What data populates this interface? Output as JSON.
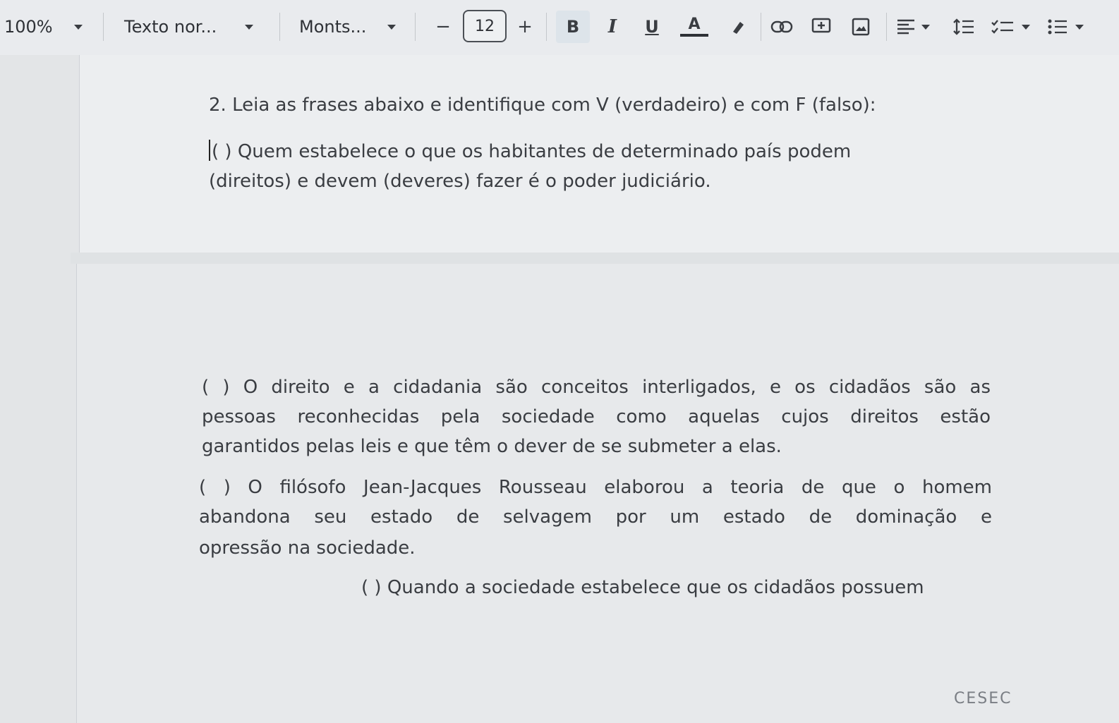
{
  "toolbar": {
    "zoom": "100%",
    "style": "Texto nor...",
    "font": "Monts...",
    "decrease": "−",
    "font_size": "12",
    "increase": "+",
    "bold": "B",
    "italic": "I",
    "underline": "U",
    "text_color": "A"
  },
  "doc": {
    "question": "2. Leia as frases abaixo e identifique com V (verdadeiro) e com F (falso):",
    "item1_line1": "( ) Quem estabelece o que os habitantes de determinado país podem",
    "item1_line2": "(direitos) e devem (deveres) fazer é o poder judiciário.",
    "item2_line1": "(  ) O direito e a cidadania são conceitos interligados, e os cidadãos são  as",
    "item2_line2": "pessoas reconhecidas pela sociedade como aquelas cujos direitos estão",
    "item2_line3": "garantidos pelas leis e que têm o dever de se submeter a elas.",
    "item3_line1": "( ) O filósofo Jean-Jacques Rousseau elaborou a teoria de que o homem",
    "item3_line2": "abandona seu estado de selvagem por um estado de dominação e",
    "item3_line3": "opressão  na sociedade.",
    "item4_line1": "( ) Quando a sociedade estabelece que os cidadãos possuem",
    "footer": "CESEC"
  }
}
